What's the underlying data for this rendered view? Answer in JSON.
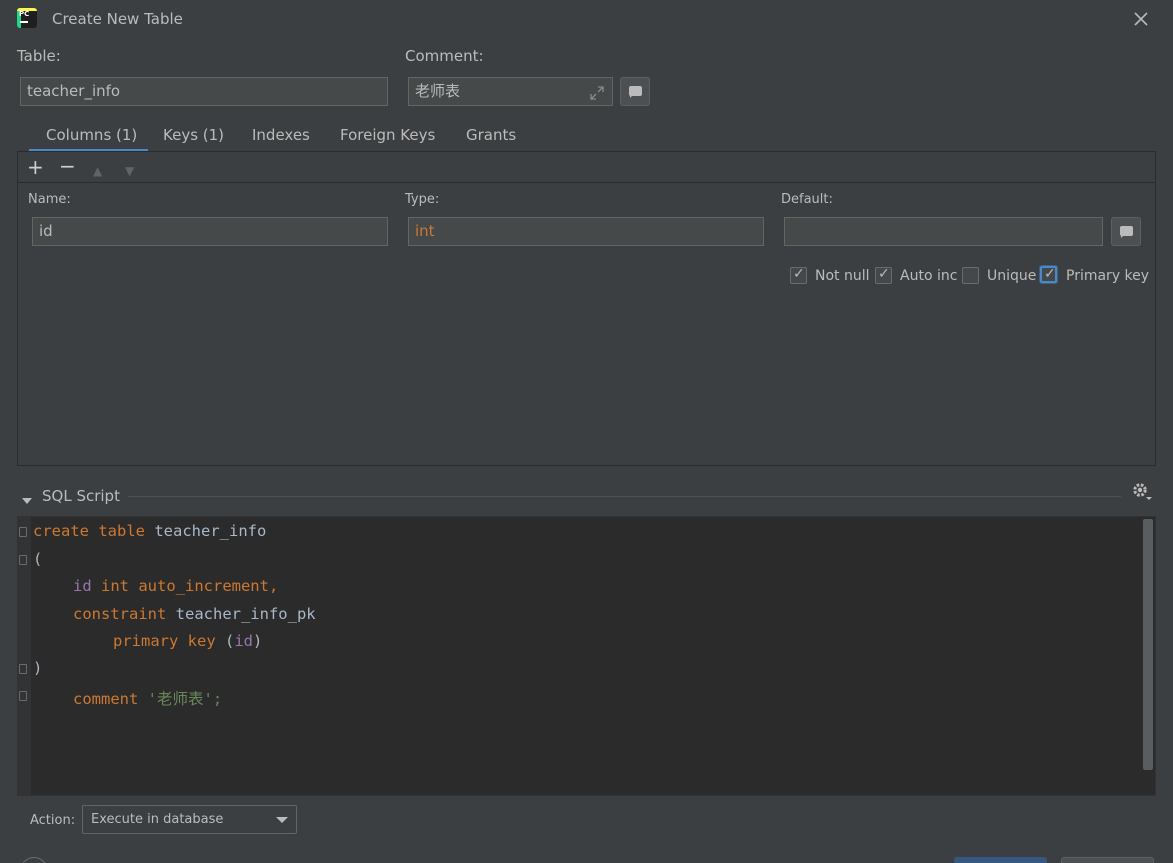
{
  "window": {
    "title": "Create New Table",
    "app_icon": "pycharm-icon",
    "app_icon_text": "PC"
  },
  "table_field": {
    "label": "Table:",
    "value": "teacher_info"
  },
  "comment_field": {
    "label": "Comment:",
    "value": "老师表"
  },
  "tabs": [
    {
      "label": "Columns (1)",
      "active": true
    },
    {
      "label": "Keys (1)",
      "active": false
    },
    {
      "label": "Indexes",
      "active": false
    },
    {
      "label": "Foreign Keys",
      "active": false
    },
    {
      "label": "Grants",
      "active": false
    }
  ],
  "toolbar": {
    "add": "+",
    "remove": "−",
    "move_up": "▲",
    "move_down": "▼"
  },
  "column": {
    "name_label": "Name:",
    "name_value": "id",
    "type_label": "Type:",
    "type_value": "int",
    "default_label": "Default:",
    "default_value": ""
  },
  "checkboxes": [
    {
      "label": "Not null",
      "checked": true
    },
    {
      "label": "Auto inc",
      "checked": true
    },
    {
      "label": "Unique",
      "checked": false
    },
    {
      "label": "Primary key",
      "checked": true
    }
  ],
  "sql_script": {
    "label": "SQL Script",
    "line1_kw": "create table ",
    "line1_name": "teacher_info",
    "line2": "(",
    "line3_id": "id",
    "line3_kw": " int auto_increment,",
    "line4_kw": "constraint ",
    "line4_name": "teacher_info_pk",
    "line5_kw": "primary key ",
    "line5_open": "(",
    "line5_id": "id",
    "line5_close": ")",
    "line6": ")",
    "line7_kw": "comment ",
    "line7_str": "'老师表';"
  },
  "action": {
    "label": "Action:",
    "value": "Execute in database"
  },
  "colors": {
    "keyword": "#cc7832",
    "identifier": "#9876aa",
    "string": "#6a8759",
    "accent": "#4a88c7"
  }
}
